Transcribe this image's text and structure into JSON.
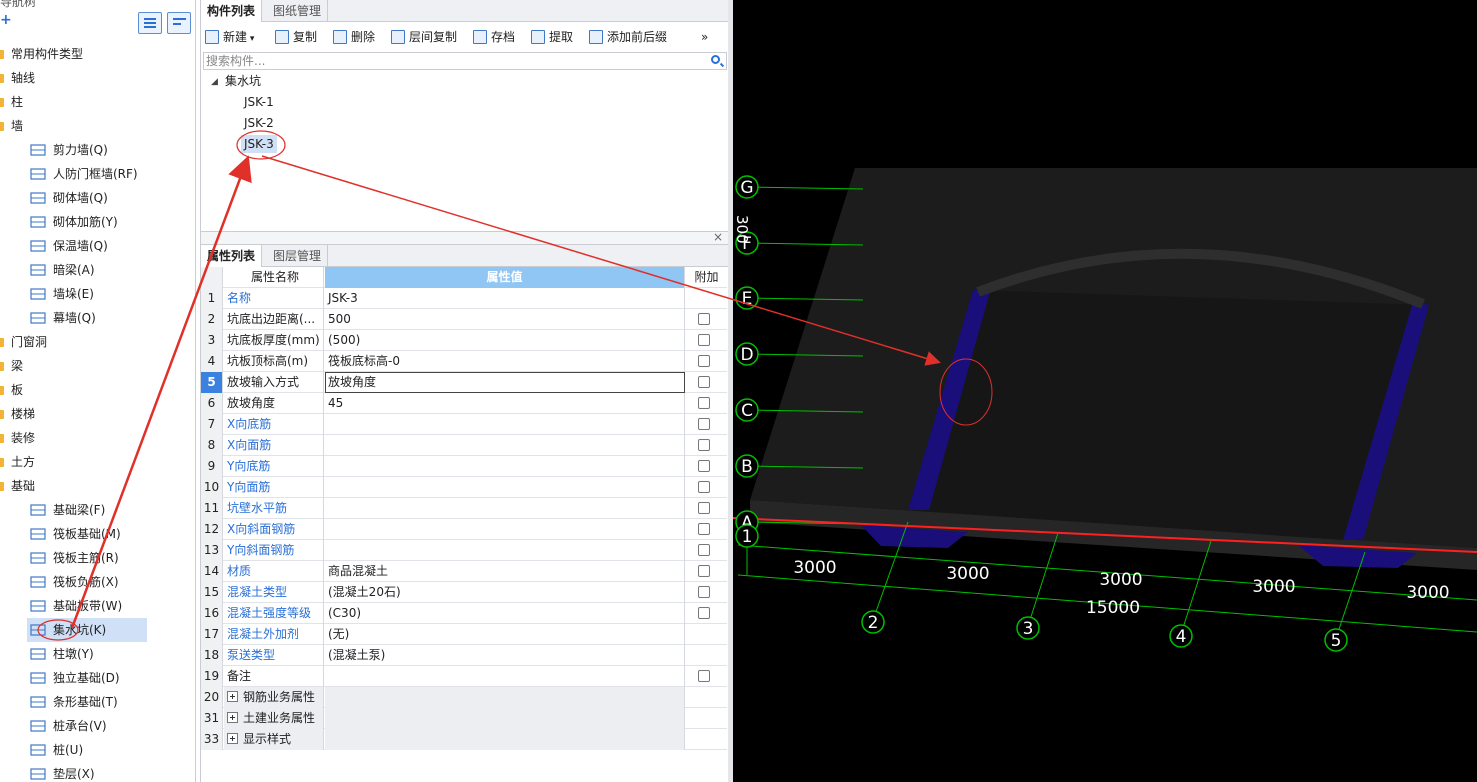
{
  "left_panel": {
    "title": "导航树",
    "add_symbol": "+",
    "categories_top": [
      {
        "label": "常用构件类型"
      },
      {
        "label": "轴线"
      },
      {
        "label": "柱"
      },
      {
        "label": "墙"
      }
    ],
    "wall_items": [
      {
        "label": "剪力墙(Q)"
      },
      {
        "label": "人防门框墙(RF)"
      },
      {
        "label": "砌体墙(Q)"
      },
      {
        "label": "砌体加筋(Y)"
      },
      {
        "label": "保温墙(Q)"
      },
      {
        "label": "暗梁(A)"
      },
      {
        "label": "墙垛(E)"
      },
      {
        "label": "幕墙(Q)"
      }
    ],
    "categories_mid": [
      {
        "label": "门窗洞"
      },
      {
        "label": "梁"
      },
      {
        "label": "板"
      },
      {
        "label": "楼梯"
      },
      {
        "label": "装修"
      },
      {
        "label": "土方"
      },
      {
        "label": "基础"
      }
    ],
    "foundation_items": [
      {
        "label": "基础梁(F)"
      },
      {
        "label": "筏板基础(M)"
      },
      {
        "label": "筏板主筋(R)"
      },
      {
        "label": "筏板负筋(X)"
      },
      {
        "label": "基础板带(W)"
      },
      {
        "label": "集水坑(K)"
      },
      {
        "label": "柱墩(Y)"
      },
      {
        "label": "独立基础(D)"
      },
      {
        "label": "条形基础(T)"
      },
      {
        "label": "桩承台(V)"
      },
      {
        "label": "桩(U)"
      },
      {
        "label": "垫层(X)"
      }
    ]
  },
  "component_panel": {
    "tabs": [
      {
        "label": "构件列表"
      },
      {
        "label": "图纸管理"
      }
    ],
    "toolbar": [
      {
        "label": "新建",
        "has_dropdown": true
      },
      {
        "label": "复制"
      },
      {
        "label": "删除"
      },
      {
        "label": "层间复制"
      },
      {
        "label": "存档"
      },
      {
        "label": "提取"
      },
      {
        "label": "添加前后缀"
      }
    ],
    "more_symbol": "»",
    "search_placeholder": "搜索构件...",
    "tree": {
      "root": "集水坑",
      "expander": "◢",
      "children": [
        "JSK-1",
        "JSK-2",
        "JSK-3"
      ],
      "selected": "JSK-3"
    }
  },
  "property_panel": {
    "close_symbol": "×",
    "tabs": [
      {
        "label": "属性列表"
      },
      {
        "label": "图层管理"
      }
    ],
    "headers": {
      "name": "属性名称",
      "value": "属性值",
      "extra": "附加"
    },
    "rows": [
      {
        "num": "1",
        "name": "名称",
        "value": "JSK-3",
        "blue": true,
        "checkbox": false
      },
      {
        "num": "2",
        "name": "坑底出边距离(...",
        "value": "500",
        "blue": false,
        "checkbox": true
      },
      {
        "num": "3",
        "name": "坑底板厚度(mm)",
        "value": "(500)",
        "blue": false,
        "checkbox": true
      },
      {
        "num": "4",
        "name": "坑板顶标高(m)",
        "value": "筏板底标高-0",
        "blue": false,
        "checkbox": true
      },
      {
        "num": "5",
        "name": "放坡输入方式",
        "value": "放坡角度",
        "blue": false,
        "checkbox": true,
        "active": true
      },
      {
        "num": "6",
        "name": "放坡角度",
        "value": "45",
        "blue": false,
        "checkbox": true
      },
      {
        "num": "7",
        "name": "X向底筋",
        "value": "",
        "blue": true,
        "checkbox": true
      },
      {
        "num": "8",
        "name": "X向面筋",
        "value": "",
        "blue": true,
        "checkbox": true
      },
      {
        "num": "9",
        "name": "Y向底筋",
        "value": "",
        "blue": true,
        "checkbox": true
      },
      {
        "num": "10",
        "name": "Y向面筋",
        "value": "",
        "blue": true,
        "checkbox": true
      },
      {
        "num": "11",
        "name": "坑壁水平筋",
        "value": "",
        "blue": true,
        "checkbox": true
      },
      {
        "num": "12",
        "name": "X向斜面钢筋",
        "value": "",
        "blue": true,
        "checkbox": true
      },
      {
        "num": "13",
        "name": "Y向斜面钢筋",
        "value": "",
        "blue": true,
        "checkbox": true
      },
      {
        "num": "14",
        "name": "材质",
        "value": "商品混凝土",
        "blue": true,
        "checkbox": true
      },
      {
        "num": "15",
        "name": "混凝土类型",
        "value": "(混凝土20石)",
        "blue": true,
        "checkbox": true
      },
      {
        "num": "16",
        "name": "混凝土强度等级",
        "value": "(C30)",
        "blue": true,
        "checkbox": true
      },
      {
        "num": "17",
        "name": "混凝土外加剂",
        "value": "(无)",
        "blue": true,
        "checkbox": false
      },
      {
        "num": "18",
        "name": "泵送类型",
        "value": "(混凝土泵)",
        "blue": true,
        "checkbox": false
      },
      {
        "num": "19",
        "name": "备注",
        "value": "",
        "blue": false,
        "checkbox": true
      },
      {
        "num": "20",
        "name": "钢筋业务属性",
        "value": "",
        "group": true
      },
      {
        "num": "31",
        "name": "土建业务属性",
        "value": "",
        "group": true
      },
      {
        "num": "33",
        "name": "显示样式",
        "value": "",
        "group": true
      }
    ]
  },
  "view3d": {
    "row_axes": [
      "G",
      "F",
      "E",
      "D",
      "C",
      "B",
      "A"
    ],
    "col_axes": [
      "1",
      "2",
      "3",
      "4",
      "5"
    ],
    "spans": [
      "3000",
      "3000",
      "3000",
      "3000",
      "3000"
    ],
    "total": "15000",
    "partial_label": "300",
    "colors": {
      "background": "#000000",
      "grid": "#00c000",
      "slab": "#1c1c1c",
      "pit_wall": "#1a0f7a",
      "axis_red": "#ff2020",
      "annotation": "#e0302a"
    }
  }
}
